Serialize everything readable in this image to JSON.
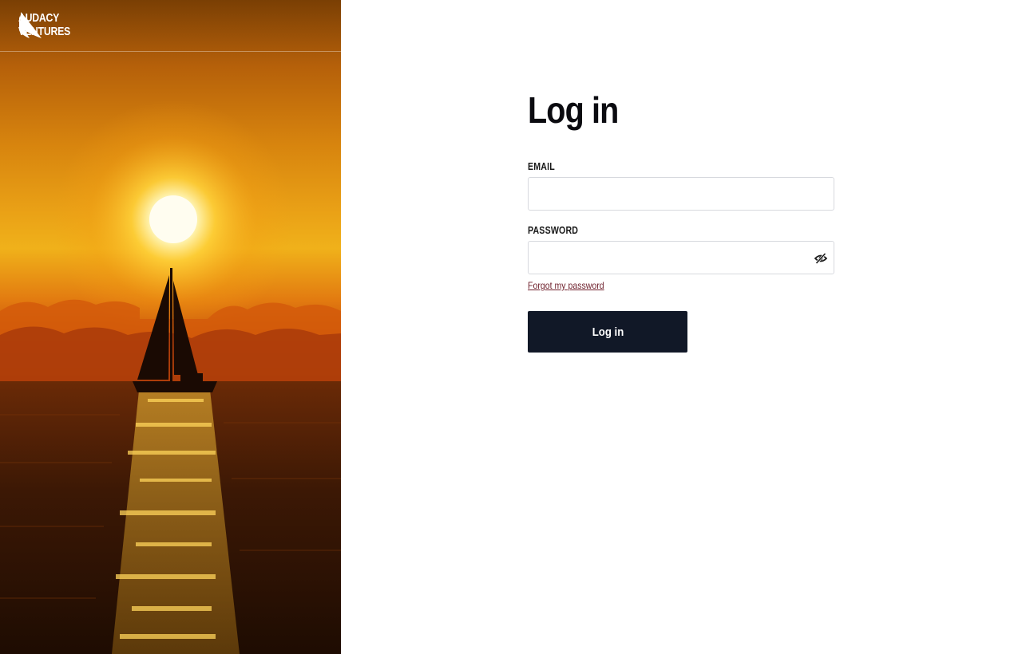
{
  "brand": {
    "line1": "AUDACY",
    "line2": "VENTURES",
    "logo_icon": "sail-logo-icon"
  },
  "login": {
    "title": "Log in",
    "email_label": "EMAIL",
    "email_value": "",
    "password_label": "PASSWORD",
    "password_value": "",
    "password_toggle_icon": "eye-slash-icon",
    "forgot_link": "Forgot my password",
    "submit_label": "Log in"
  },
  "colors": {
    "button_bg": "#111827",
    "link": "#6e1f2b",
    "hero_sky": "#e9a016",
    "hero_sea": "#1c0c02"
  }
}
